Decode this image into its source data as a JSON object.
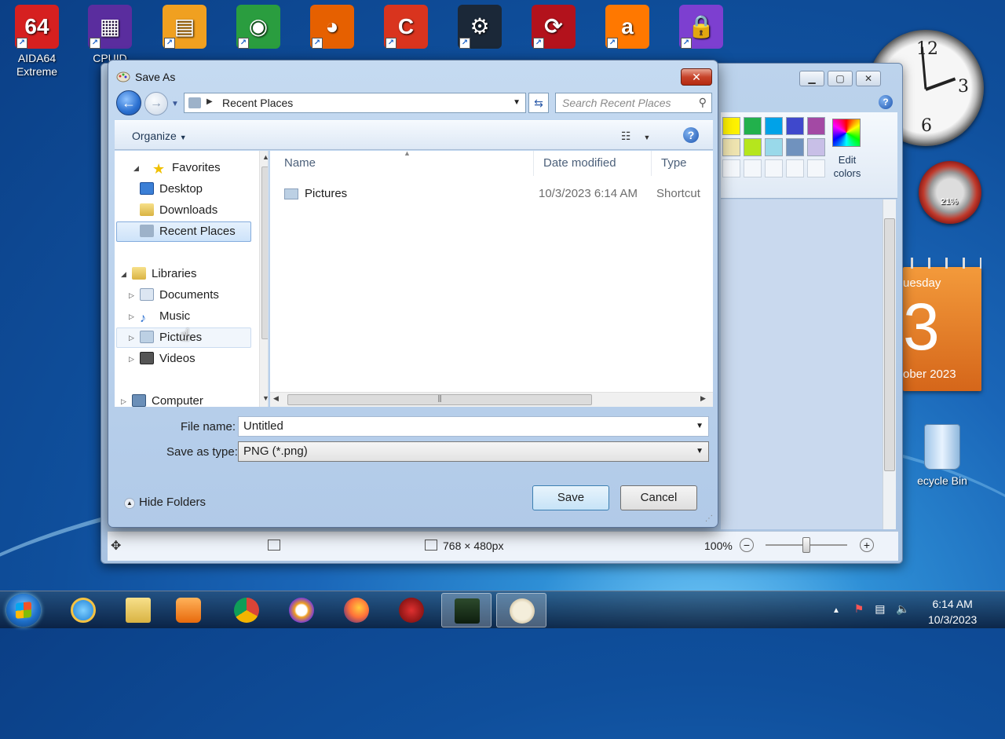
{
  "desktop": {
    "icons": [
      {
        "name": "aida64-icon",
        "label": "AIDA64\nExtreme",
        "color": "#d62020",
        "glyph": "64"
      },
      {
        "name": "cpuid-icon",
        "label": "CPUID",
        "color": "#5a2d9e",
        "glyph": "▦"
      },
      {
        "name": "winrar-icon",
        "label": "",
        "color": "#f0a020",
        "glyph": "▤"
      },
      {
        "name": "chrome-icon",
        "label": "",
        "color": "#2a9d3f",
        "glyph": "◉"
      },
      {
        "name": "firefox-icon",
        "label": "",
        "color": "#e66000",
        "glyph": "◕"
      },
      {
        "name": "ccleaner-icon",
        "label": "",
        "color": "#d9341e",
        "glyph": "C"
      },
      {
        "name": "steam-icon",
        "label": "",
        "color": "#1b2838",
        "glyph": "⚙"
      },
      {
        "name": "driverbooster-icon",
        "label": "",
        "color": "#b3121c",
        "glyph": "⟳"
      },
      {
        "name": "avast-icon",
        "label": "",
        "color": "#ff7800",
        "glyph": "a"
      },
      {
        "name": "vpn-icon",
        "label": "",
        "color": "#7d3fd0",
        "glyph": "🔒"
      }
    ],
    "calendar": {
      "day": "uesday",
      "date": "3",
      "month": "ober 2023"
    },
    "meter_value": "21%",
    "recycle_label": "ecycle Bin"
  },
  "paint": {
    "edit_colors": "Edit colors",
    "zoom": "100%",
    "canvas_size": "768 × 480px",
    "palette_row1": [
      "#fff200",
      "#22b14c",
      "#00a2e8",
      "#3f48cc",
      "#a349a4"
    ],
    "palette_row2": [
      "#efe4b0",
      "#b5e61d",
      "#99d9ea",
      "#7092be",
      "#c8bfe7"
    ]
  },
  "dialog": {
    "title": "Save As",
    "address": "Recent Places",
    "search_placeholder": "Search Recent Places",
    "organize": "Organize",
    "nav": {
      "favorites": "Favorites",
      "desktop": "Desktop",
      "downloads": "Downloads",
      "recent_places": "Recent Places",
      "libraries": "Libraries",
      "documents": "Documents",
      "music": "Music",
      "pictures": "Pictures",
      "videos": "Videos",
      "computer": "Computer"
    },
    "columns": {
      "name": "Name",
      "date_modified": "Date modified",
      "type": "Type"
    },
    "files": [
      {
        "name": "Pictures",
        "date": "10/3/2023 6:14 AM",
        "type": "Shortcut"
      }
    ],
    "file_name_label": "File name:",
    "file_name_value": "Untitled",
    "save_type_label": "Save as type:",
    "save_type_value": "PNG (*.png)",
    "hide_folders": "Hide Folders",
    "save_button": "Save",
    "cancel_button": "Cancel"
  },
  "taskbar": {
    "time": "6:14 AM",
    "date": "10/3/2023"
  }
}
